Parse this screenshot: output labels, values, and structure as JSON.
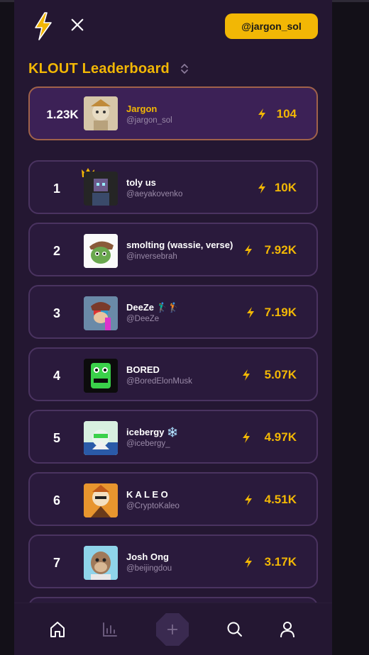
{
  "header": {
    "handle_button": "@jargon_sol"
  },
  "title": "KLOUT Leaderboard",
  "me": {
    "score": "1.23K",
    "name": "Jargon",
    "handle": "@jargon_sol",
    "klout": "104"
  },
  "leaders": [
    {
      "rank": "1",
      "name": "toly us",
      "handle": "@aeyakovenko",
      "klout": "10K"
    },
    {
      "rank": "2",
      "name": "smolting (wassie, verse)",
      "handle": "@inversebrah",
      "klout": "7.92K"
    },
    {
      "rank": "3",
      "name": "DeeZe 🏌️‍♂️🏌",
      "handle": "@DeeZe",
      "klout": "7.19K"
    },
    {
      "rank": "4",
      "name": "BORED",
      "handle": "@BoredElonMusk",
      "klout": "5.07K"
    },
    {
      "rank": "5",
      "name": "icebergy ❄️",
      "handle": "@icebergy_",
      "klout": "4.97K"
    },
    {
      "rank": "6",
      "name": "K A L E O",
      "handle": "@CryptoKaleo",
      "klout": "4.51K"
    },
    {
      "rank": "7",
      "name": "Josh Ong",
      "handle": "@beijingdou",
      "klout": "3.17K"
    }
  ],
  "colors": {
    "accent": "#f2b705",
    "background": "#241732",
    "card": "#2a1a3c",
    "card_border": "#4a3360"
  },
  "icons": [
    "lightning-logo-icon",
    "x-logo-icon",
    "sort-icon",
    "bolt-icon",
    "crown-icon",
    "home-icon",
    "chart-icon",
    "plus-icon",
    "search-icon",
    "profile-icon"
  ]
}
